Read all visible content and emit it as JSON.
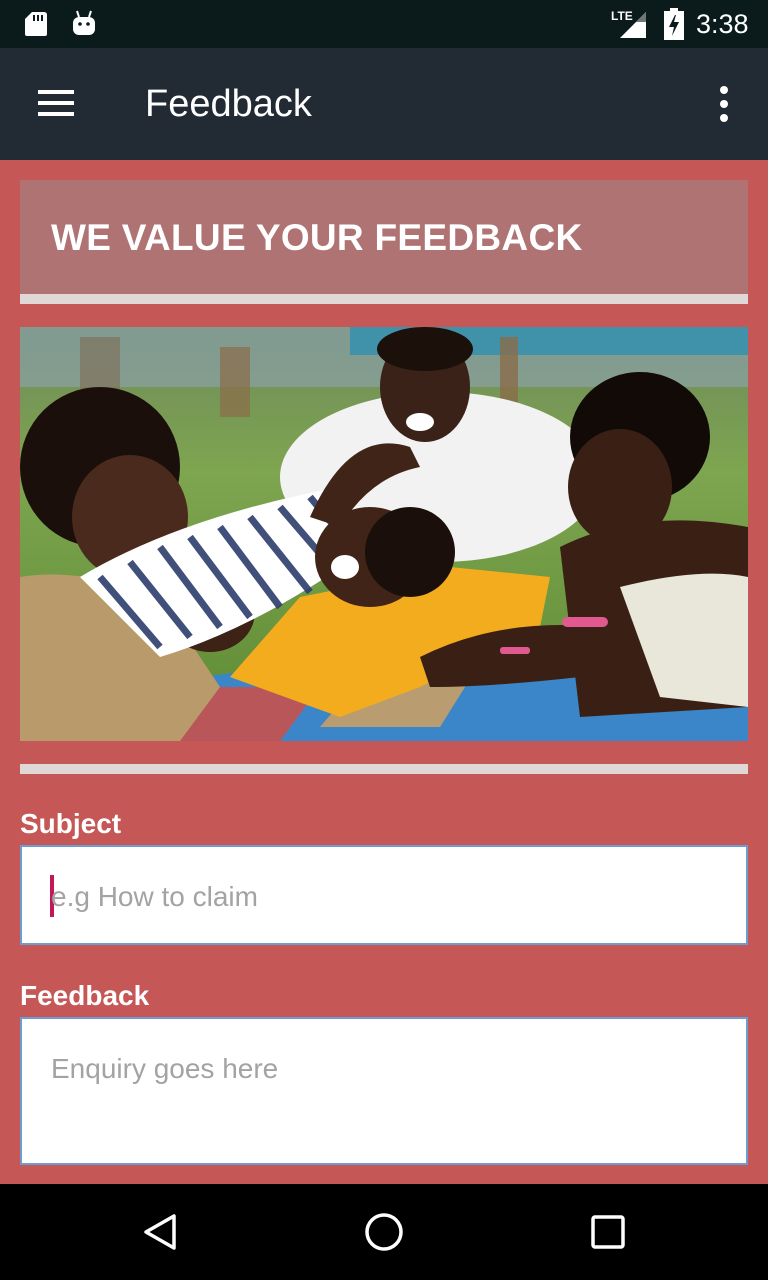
{
  "status_bar": {
    "network": "LTE",
    "time": "3:38",
    "icons": [
      "sd-card-icon",
      "android-icon",
      "signal-icon",
      "battery-charging-icon"
    ]
  },
  "app_bar": {
    "title": "Feedback",
    "icons": [
      "menu-icon",
      "more-vert-icon"
    ]
  },
  "banner": {
    "heading": "WE VALUE YOUR FEEDBACK"
  },
  "hero_image": {
    "description_icon": "family-photo"
  },
  "form": {
    "subject": {
      "label": "Subject",
      "value": "",
      "placeholder": "e.g How to claim"
    },
    "feedback": {
      "label": "Feedback",
      "value": "",
      "placeholder": "Enquiry goes here"
    }
  },
  "nav_bar": {
    "icons": [
      "back-icon",
      "home-icon",
      "recents-icon"
    ]
  },
  "colors": {
    "background": "#c55757",
    "app_bar": "#222b33",
    "status_bar": "#0b1a1a",
    "banner": "#b07374",
    "divider": "#e0d7d7",
    "input_border": "#6e9bd0",
    "caret": "#c2185b"
  }
}
